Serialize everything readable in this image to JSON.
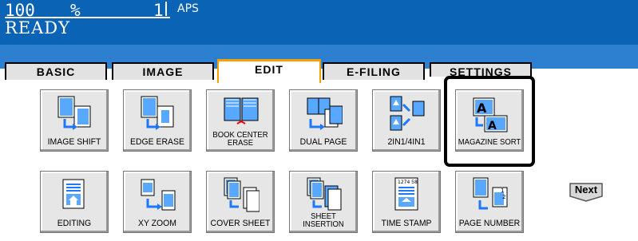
{
  "status": {
    "zoom": "100",
    "zoom_unit": "%",
    "copies": "1",
    "paper": "APS",
    "state": "READY"
  },
  "tabs": [
    "BASIC",
    "IMAGE",
    "EDIT",
    "E-FILING",
    "SETTINGS"
  ],
  "active_tab": "EDIT",
  "buttons_row1": [
    {
      "label": "IMAGE SHIFT",
      "icon": "image-shift-icon"
    },
    {
      "label": "EDGE ERASE",
      "icon": "edge-erase-icon"
    },
    {
      "label": "BOOK CENTER",
      "label2": "ERASE",
      "icon": "book-center-erase-icon"
    },
    {
      "label": "DUAL PAGE",
      "icon": "dual-page-icon"
    },
    {
      "label": "2IN1/4IN1",
      "icon": "2in1-4in1-icon"
    },
    {
      "label": "MAGAZINE SORT",
      "icon": "magazine-sort-icon"
    }
  ],
  "buttons_row2": [
    {
      "label": "EDITING",
      "icon": "editing-icon"
    },
    {
      "label": "XY ZOOM",
      "icon": "xy-zoom-icon"
    },
    {
      "label": "COVER SHEET",
      "icon": "cover-sheet-icon"
    },
    {
      "label": "SHEET",
      "label2": "INSERTION",
      "icon": "sheet-insertion-icon"
    },
    {
      "label": "TIME STAMP",
      "icon": "time-stamp-icon"
    },
    {
      "label": "PAGE NUMBER",
      "icon": "page-number-icon"
    }
  ],
  "next_button": "Next",
  "colors": {
    "status_bg": "#0a63b4",
    "band": "#2d7fd0",
    "active_tab_border": "#f5a000",
    "icon_blue": "#1e90ff"
  }
}
